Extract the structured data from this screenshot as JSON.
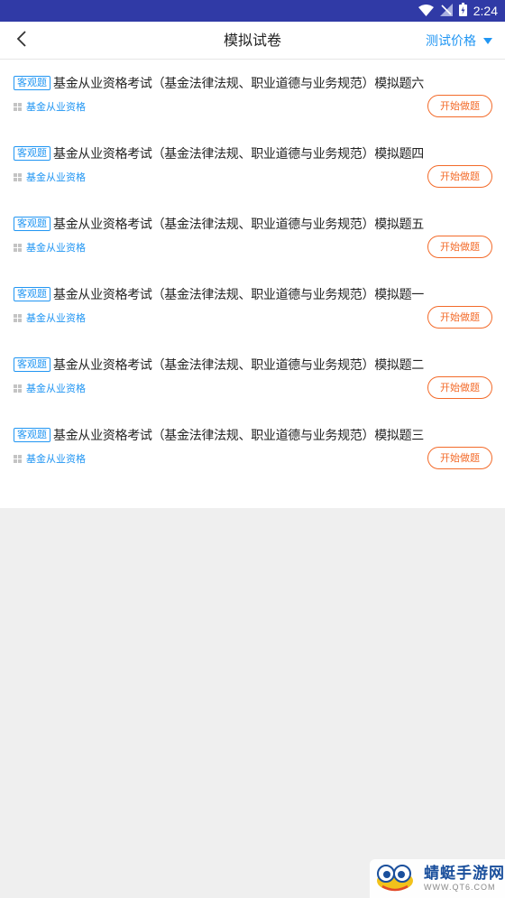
{
  "status_bar": {
    "time": "2:24",
    "icons": [
      "wifi-icon",
      "no-signal-icon",
      "battery-icon"
    ]
  },
  "header": {
    "title": "模拟试卷",
    "filter_label": "测试价格",
    "back_icon": "chevron-left-icon",
    "filter_icon": "triangle-down-icon"
  },
  "papers": [
    {
      "badge": "客观题",
      "title": "基金从业资格考试（基金法律法规、职业道德与业务规范）模拟题六",
      "category": "基金从业资格",
      "action": "开始做题"
    },
    {
      "badge": "客观题",
      "title": "基金从业资格考试（基金法律法规、职业道德与业务规范）模拟题四",
      "category": "基金从业资格",
      "action": "开始做题"
    },
    {
      "badge": "客观题",
      "title": "基金从业资格考试（基金法律法规、职业道德与业务规范）模拟题五",
      "category": "基金从业资格",
      "action": "开始做题"
    },
    {
      "badge": "客观题",
      "title": "基金从业资格考试（基金法律法规、职业道德与业务规范）模拟题一",
      "category": "基金从业资格",
      "action": "开始做题"
    },
    {
      "badge": "客观题",
      "title": "基金从业资格考试（基金法律法规、职业道德与业务规范）模拟题二",
      "category": "基金从业资格",
      "action": "开始做题"
    },
    {
      "badge": "客观题",
      "title": "基金从业资格考试（基金法律法规、职业道德与业务规范）模拟题三",
      "category": "基金从业资格",
      "action": "开始做题"
    }
  ],
  "watermark": {
    "name": "蜻蜓手游网",
    "url": "WWW.QT6.COM"
  },
  "colors": {
    "status_bar": "#303aa6",
    "accent": "#2196f3",
    "action": "#f36b2a",
    "background": "#efefef"
  }
}
